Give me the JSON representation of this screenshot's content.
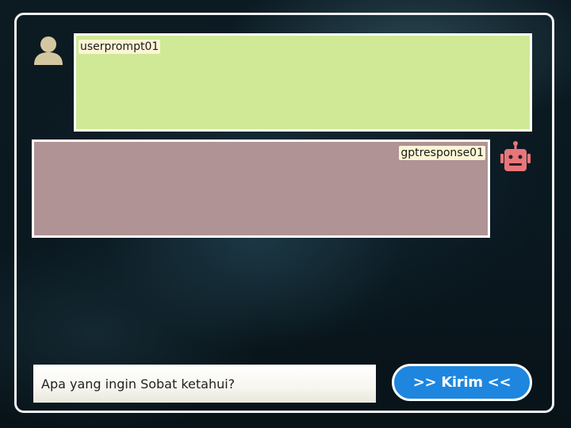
{
  "colors": {
    "user_bubble": "#cfe996",
    "bot_bubble": "#b09394",
    "send_button": "#1e86df",
    "frame": "#f3f3f3",
    "user_avatar": "#d4c7a0",
    "bot_avatar": "#e7767a"
  },
  "icons": {
    "user": "user-icon",
    "bot": "robot-icon"
  },
  "chat": {
    "messages": [
      {
        "role": "user",
        "text": "userprompt01"
      },
      {
        "role": "assistant",
        "text": "gptresponse01"
      }
    ]
  },
  "composer": {
    "placeholder": "Apa yang ingin Sobat ketahui?",
    "value": "",
    "send_label": ">> Kirim <<"
  }
}
